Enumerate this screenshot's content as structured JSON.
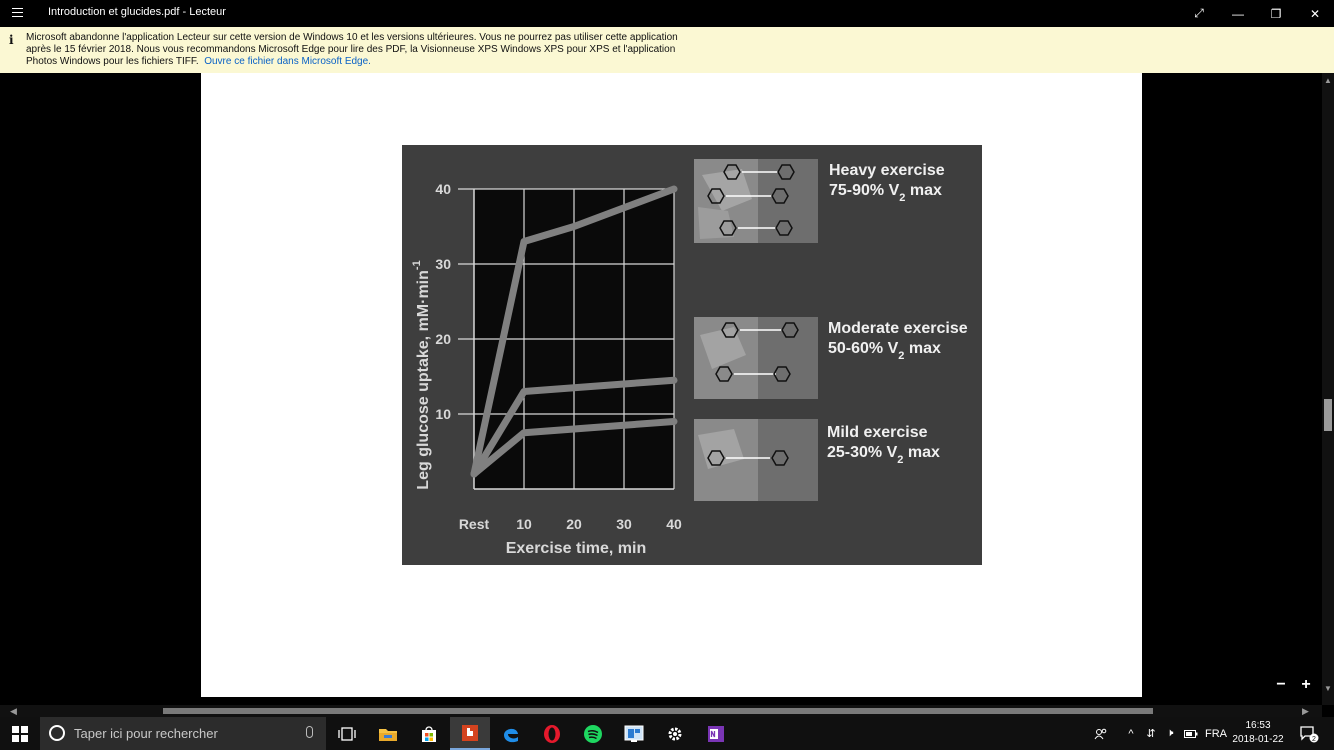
{
  "window": {
    "title": "Introduction et glucides.pdf - Lecteur",
    "controls": {
      "fullscreen": "⤢",
      "minimize": "—",
      "restore": "❐",
      "close": "✕"
    }
  },
  "banner": {
    "message": "Microsoft abandonne l'application Lecteur sur cette version de Windows 10 et les versions ultérieures. Vous ne pourrez pas utiliser cette application après le 15 février 2018. Nous vous recommandons Microsoft Edge pour lire des PDF, la Visionneuse XPS Windows XPS pour XPS et l'application Photos Windows pour les fichiers TIFF.",
    "link": "Ouvre ce fichier dans Microsoft Edge."
  },
  "figure": {
    "ylabel": "Leg glucose uptake, mM·min",
    "ylabel_exp": "-1",
    "xlabel": "Exercise time, min",
    "heavy_title": "Heavy exercise",
    "heavy_pct": "75-90% V",
    "moderate_title": "Moderate exercise",
    "moderate_pct": "50-60% V",
    "mild_title": "Mild exercise",
    "mild_pct": "25-30% V",
    "vo2_sub": "2",
    "vo2_max": " max"
  },
  "chart_data": {
    "type": "line",
    "xlabel": "Exercise time, min",
    "ylabel": "Leg glucose uptake, mM·min-1",
    "categories": [
      "Rest",
      "10",
      "20",
      "30",
      "40"
    ],
    "yticks": [
      "10",
      "20",
      "30",
      "40"
    ],
    "ylim": [
      0,
      40
    ],
    "series": [
      {
        "name": "Heavy exercise 75-90% VO2 max",
        "values": [
          2,
          33,
          35,
          37.5,
          40
        ]
      },
      {
        "name": "Moderate exercise 50-60% VO2 max",
        "values": [
          2,
          13,
          13.5,
          14,
          14.5
        ]
      },
      {
        "name": "Mild exercise 25-30% VO2 max",
        "values": [
          2,
          7.5,
          8,
          8.5,
          9
        ]
      }
    ],
    "grid": true,
    "legend": "right",
    "colors": {
      "background": "#3e3e3e",
      "plot": "#0a0a0a",
      "line": "#808080",
      "grid": "#d8d8d8"
    }
  },
  "taskbar": {
    "search_placeholder": "Taper ici pour rechercher",
    "language": "FRA",
    "time": "16:53",
    "date": "2018-01-22",
    "notification_count": "2",
    "pinned": [
      "task-view-icon",
      "file-explorer-icon",
      "store-icon",
      "reader-icon",
      "edge-icon",
      "opera-icon",
      "spotify-icon",
      "app-icon",
      "settings-icon",
      "onenote-icon"
    ]
  },
  "zoom": {
    "minus": "−",
    "plus": "+"
  }
}
